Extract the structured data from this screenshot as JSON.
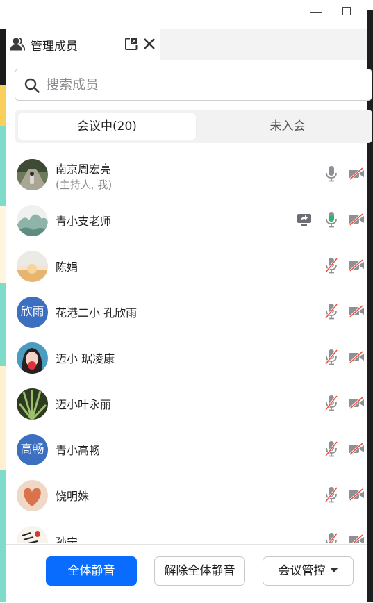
{
  "window": {
    "minimize_icon": "minimize-icon",
    "maximize_icon": "maximize-icon"
  },
  "panel": {
    "tab_title": "管理成员",
    "tab_icon": "user-icon",
    "popout_icon": "popout-icon",
    "close_icon": "close-icon"
  },
  "search": {
    "placeholder": "搜索成员",
    "value": ""
  },
  "segments": {
    "in_meeting": "会议中(20)",
    "not_joined": "未入会",
    "active": "in_meeting"
  },
  "members": [
    {
      "name": "南京周宏亮",
      "subtitle": "(主持人, 我)",
      "avatar": "photo-child-path",
      "mic": "on-gray",
      "camera": "off"
    },
    {
      "name": "青小支老师",
      "avatar": "photo-landscape-painting",
      "screen_share": true,
      "mic": "on-green",
      "camera": "off"
    },
    {
      "name": "陈娟",
      "avatar": "photo-sunset-sky",
      "mic": "off",
      "camera": "off"
    },
    {
      "name": "花港二小 孔欣雨",
      "avatar_text": "欣雨",
      "mic": "off",
      "camera": "off"
    },
    {
      "name": "迈小 琚凌康",
      "avatar": "photo-cartoon-girl",
      "mic": "off",
      "camera": "off"
    },
    {
      "name": "迈小叶永丽",
      "avatar": "photo-plant",
      "mic": "off",
      "camera": "off"
    },
    {
      "name": "青小高畅",
      "avatar_text": "高畅",
      "mic": "off",
      "camera": "off"
    },
    {
      "name": "饶明姝",
      "avatar": "photo-heart-hands",
      "mic": "off",
      "camera": "off"
    },
    {
      "name": "孙宁",
      "avatar": "photo-sketch",
      "mic": "off",
      "camera": "off"
    }
  ],
  "footer": {
    "mute_all": "全体静音",
    "unmute_all": "解除全体静音",
    "meeting_control": "会议管控"
  },
  "colors": {
    "primary": "#0a6cff",
    "mic_active": "#2bb673",
    "muted_red": "#e8533f",
    "icon_gray": "#8e9096",
    "avatar_blue": "#3d6fc0"
  }
}
